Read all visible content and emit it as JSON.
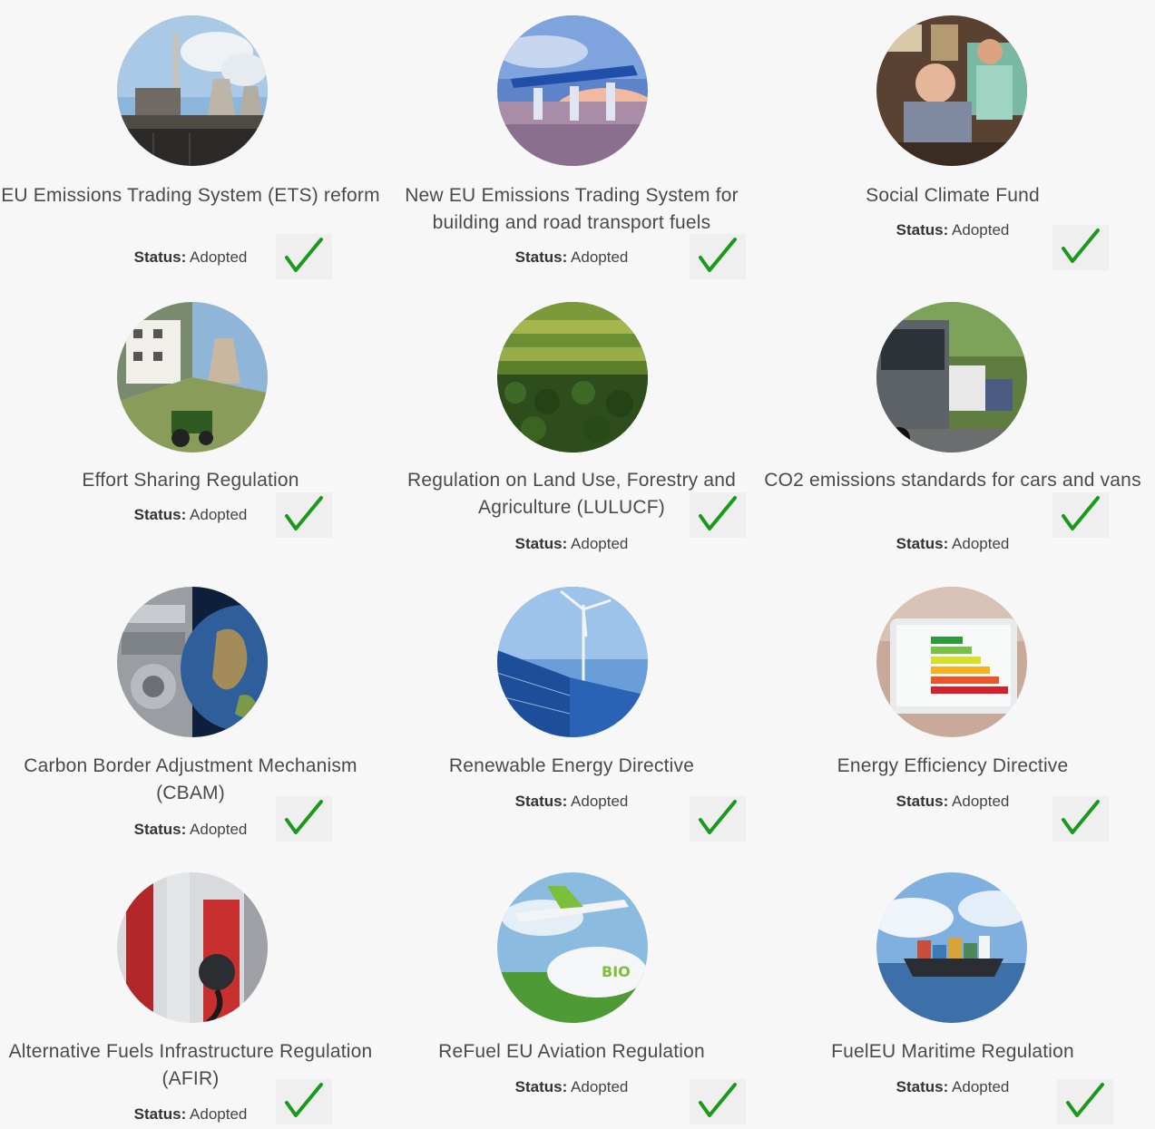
{
  "status_label": "Status:",
  "items": [
    {
      "title": "EU Emissions Trading System (ETS) reform",
      "status": "Adopted"
    },
    {
      "title": "New EU Emissions Trading System for building and road transport fuels",
      "status": "Adopted"
    },
    {
      "title": "Social Climate Fund",
      "status": "Adopted"
    },
    {
      "title": "Effort Sharing Regulation",
      "status": "Adopted"
    },
    {
      "title": "Regulation on Land Use, Forestry and Agriculture (LULUCF)",
      "status": "Adopted"
    },
    {
      "title": "CO2 emissions standards for cars and vans",
      "status": "Adopted"
    },
    {
      "title": "Carbon Border Adjustment Mechanism (CBAM)",
      "status": "Adopted"
    },
    {
      "title": "Renewable Energy Directive",
      "status": "Adopted"
    },
    {
      "title": "Energy Efficiency Directive",
      "status": "Adopted"
    },
    {
      "title": "Alternative Fuels Infrastructure Regulation (AFIR)",
      "status": "Adopted"
    },
    {
      "title": "ReFuel EU Aviation Regulation",
      "status": "Adopted"
    },
    {
      "title": "FuelEU Maritime Regulation",
      "status": "Adopted"
    }
  ],
  "icons": {
    "check": "checkmark-icon"
  },
  "colors": {
    "check": "#1a9a1a",
    "background": "#f7f7f7",
    "title_text": "#4a4a4a"
  }
}
